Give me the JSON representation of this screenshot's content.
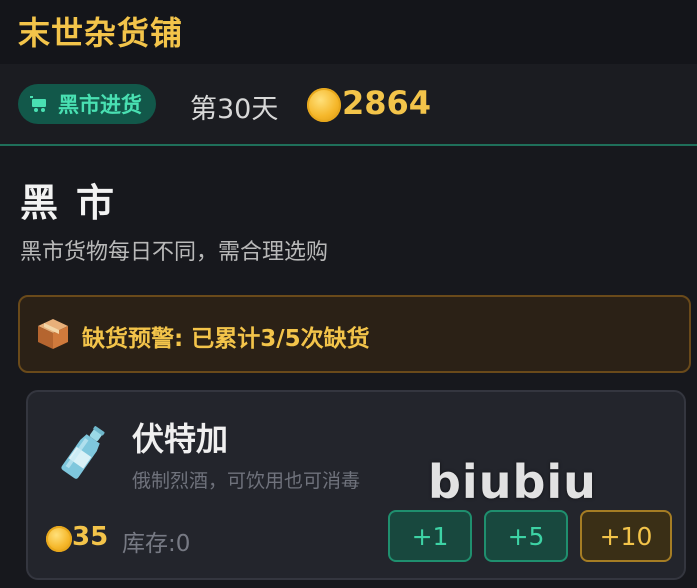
{
  "app": {
    "title": "末世杂货铺"
  },
  "status": {
    "mode_label": "黑市进货",
    "day": "第30天",
    "gold": "2864"
  },
  "section": {
    "title": "黑市",
    "description": "黑市货物每日不同，需合理选购"
  },
  "warning": {
    "text": "缺货预警: 已累计3/5次缺货"
  },
  "item": {
    "name": "伏特加",
    "description": "俄制烈酒，可饮用也可消毒",
    "price": "35",
    "stock": "库存:0",
    "buttons": [
      "+1",
      "+5",
      "+10"
    ]
  },
  "watermark": "biubiu",
  "colors": {
    "accent_gold": "#f3c44a",
    "accent_green": "#3dd3a5",
    "background": "#17181d"
  }
}
